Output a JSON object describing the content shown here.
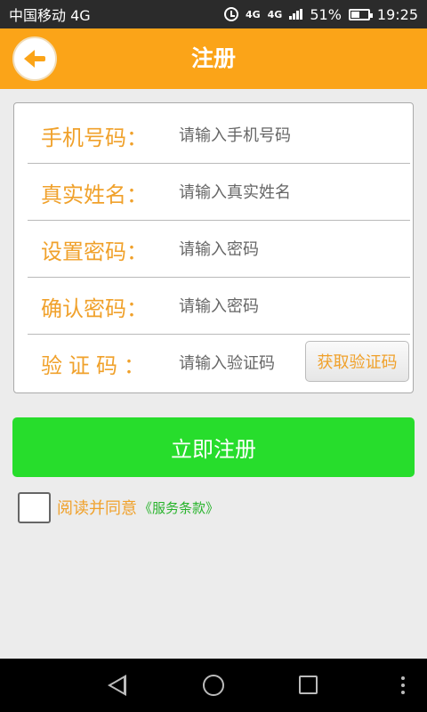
{
  "status_bar": {
    "carrier": "中国移动 4G",
    "network_primary": "4G",
    "network_secondary": "4G",
    "battery": "51%",
    "time": "19:25"
  },
  "header": {
    "title": "注册",
    "back_icon": "arrow-left-icon"
  },
  "form": {
    "phone": {
      "label": "手机号码：",
      "placeholder": "请输入手机号码"
    },
    "name": {
      "label": "真实姓名：",
      "placeholder": "请输入真实姓名"
    },
    "password": {
      "label": "设置密码：",
      "placeholder": "请输入密码"
    },
    "confirm": {
      "label": "确认密码：",
      "placeholder": "请输入密码"
    },
    "code": {
      "label": "验证码：",
      "placeholder": "请输入验证码",
      "button": "获取验证码"
    }
  },
  "register_button": "立即注册",
  "agreement": {
    "text": "阅读并同意",
    "terms": "《服务条款》",
    "checked": false
  },
  "colors": {
    "accent": "#fba418",
    "label": "#f0a12b",
    "primary_button": "#27dd2c",
    "terms_link": "#27b32b"
  },
  "nav_bar": {
    "back_icon": "triangle-back-icon",
    "home_icon": "circle-home-icon",
    "recent_icon": "square-recent-icon",
    "menu_icon": "dots-menu-icon"
  }
}
